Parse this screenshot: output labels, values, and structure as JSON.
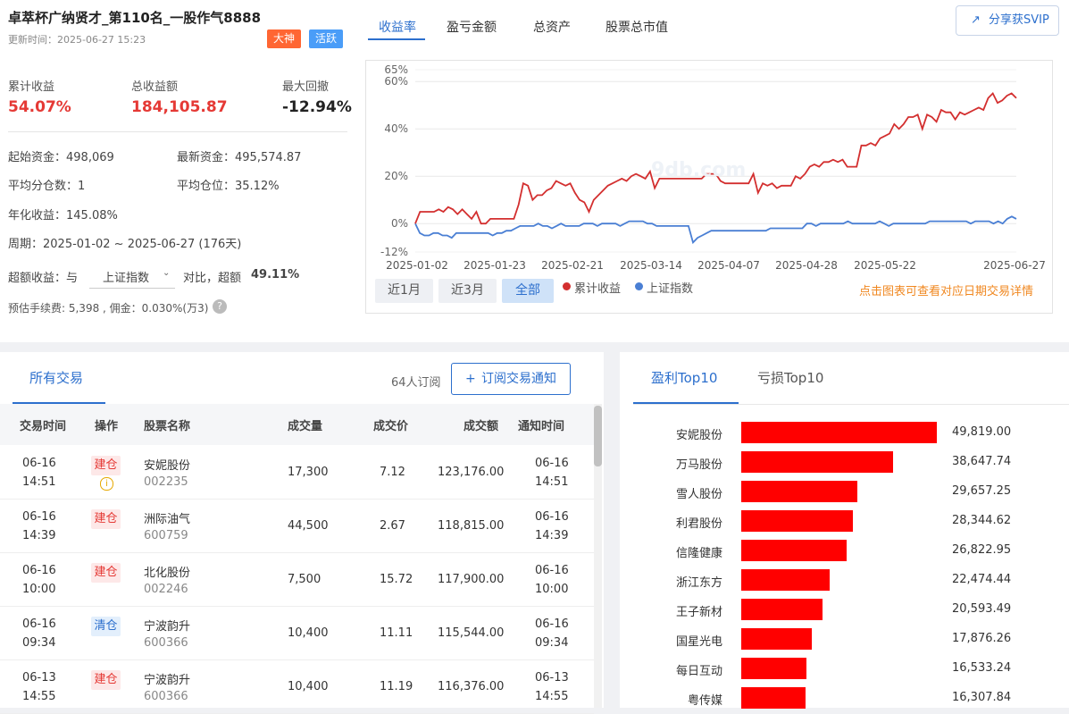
{
  "header": {
    "title": "卓萃杯广纳贤才_第110名_一股作气8888",
    "updated": "更新时间：2025-06-27 15:23",
    "badges": [
      {
        "label": "大神",
        "color": "#ff6633"
      },
      {
        "label": "活跃",
        "color": "#4a9df8"
      }
    ]
  },
  "stats": {
    "cumulative_label": "累计收益",
    "cumulative_value": "54.07%",
    "total_label": "总收益额",
    "total_value": "184,105.87",
    "drawdown_label": "最大回撤",
    "drawdown_value": "-12.94%"
  },
  "details": {
    "start_capital": "起始资金：498,069",
    "latest_capital": "最新资金：495,574.87",
    "avg_holdings": "平均分仓数：1",
    "avg_position": "平均仓位：35.12%",
    "annual": "年化收益：145.08%",
    "period": "周期：2025-01-02 ~ 2025-06-27 (176天)",
    "excess_prefix": "超额收益：与",
    "benchmark": "上证指数",
    "excess_mid": "对比，超额",
    "excess_value": "49.11%",
    "fees": "预估手续费: 5,398 , 佣金：0.030%(万3)"
  },
  "chart_tabs": [
    "收益率",
    "盈亏金额",
    "总资产",
    "股票总市值"
  ],
  "share_button": "分享获SVIP",
  "range_buttons": [
    "近1月",
    "近3月",
    "全部"
  ],
  "chart_hint": "点击图表可查看对应日期交易详情",
  "chart_data": {
    "type": "line",
    "y_ticks": [
      "65%",
      "60%",
      "40%",
      "20%",
      "0%",
      "-12%"
    ],
    "ylim": [
      -12,
      65
    ],
    "x_ticks": [
      "2025-01-02",
      "2025-01-23",
      "2025-02-21",
      "2025-03-14",
      "2025-04-07",
      "2025-04-28",
      "2025-05-22",
      "2025-06-27"
    ],
    "series": [
      {
        "name": "累计收益",
        "color": "#d32f2f",
        "values": [
          0,
          5,
          5,
          5,
          5,
          6,
          5,
          7,
          6,
          4,
          6,
          4,
          2,
          5,
          0,
          0,
          2,
          2,
          2,
          2,
          2,
          2,
          8,
          17,
          16,
          10,
          12,
          12,
          14,
          15,
          18,
          17,
          16,
          17,
          13,
          10,
          9,
          5,
          10,
          12,
          14,
          16,
          17,
          18,
          19,
          18,
          20,
          21,
          20,
          19,
          22,
          15,
          19,
          19,
          19,
          19,
          19,
          19,
          19,
          19,
          19,
          19,
          21,
          21,
          21,
          18,
          17,
          17,
          17,
          17,
          17,
          17,
          21,
          13,
          17,
          16,
          17,
          15,
          16,
          16,
          16,
          20,
          19,
          21,
          24,
          25,
          24,
          26,
          26,
          27,
          26,
          27,
          24,
          24,
          24,
          33,
          33,
          34,
          33,
          36,
          37,
          38,
          42,
          40,
          42,
          45,
          45,
          46,
          40,
          46,
          45,
          43,
          48,
          47,
          47,
          44,
          47,
          46,
          47,
          48,
          49,
          48,
          53,
          55,
          51,
          52,
          54,
          55,
          53
        ]
      },
      {
        "name": "上证指数",
        "color": "#4a7fd4",
        "values": [
          0,
          -4,
          -5,
          -5,
          -4,
          -4,
          -5,
          -5,
          -6,
          -4,
          -4,
          -4,
          -4,
          -4,
          -4,
          -4,
          -4,
          -5,
          -4,
          -4,
          -3,
          -3,
          -2,
          -1,
          -1,
          -1,
          -1,
          0,
          -1,
          -1,
          -2,
          -1,
          0,
          -1,
          -1,
          -1,
          -1,
          0,
          0,
          0,
          -1,
          0,
          0,
          0,
          0,
          -1,
          0,
          1,
          1,
          1,
          1,
          0,
          0,
          -1,
          -1,
          -1,
          -1,
          -1,
          -1,
          -1,
          -1,
          -8,
          -6,
          -5,
          -4,
          -3,
          -3,
          -3,
          -3,
          -3,
          -3,
          -3,
          -3,
          -3,
          -3,
          -3,
          -3,
          -3,
          -2,
          -2,
          -2,
          -2,
          -2,
          -2,
          -2,
          -2,
          0,
          0,
          -1,
          0,
          0,
          0,
          0,
          0,
          0,
          1,
          0,
          0,
          0,
          0,
          0,
          0,
          1,
          0,
          -1,
          0,
          0,
          0,
          0,
          0,
          0,
          0,
          0,
          1,
          1,
          1,
          1,
          1,
          1,
          1,
          1,
          1,
          0,
          1,
          1,
          1,
          1,
          0,
          1,
          0,
          2,
          3,
          2
        ]
      }
    ]
  },
  "trades": {
    "tab": "所有交易",
    "subscribers": "64人订阅",
    "subscribe_button": "订阅交易通知",
    "columns": [
      "交易时间",
      "操作",
      "股票名称",
      "成交量",
      "成交价",
      "成交额",
      "通知时间"
    ],
    "rows": [
      {
        "date": "06-16",
        "time": "14:51",
        "op": "建仓",
        "kind": "build",
        "name": "安妮股份",
        "code": "002235",
        "vol": "17,300",
        "price": "7.12",
        "amount": "123,176.00",
        "ndate": "06-16",
        "ntime": "14:51",
        "info": true
      },
      {
        "date": "06-16",
        "time": "14:39",
        "op": "建仓",
        "kind": "build",
        "name": "洲际油气",
        "code": "600759",
        "vol": "44,500",
        "price": "2.67",
        "amount": "118,815.00",
        "ndate": "06-16",
        "ntime": "14:39",
        "info": false
      },
      {
        "date": "06-16",
        "time": "10:00",
        "op": "建仓",
        "kind": "build",
        "name": "北化股份",
        "code": "002246",
        "vol": "7,500",
        "price": "15.72",
        "amount": "117,900.00",
        "ndate": "06-16",
        "ntime": "10:00",
        "info": false
      },
      {
        "date": "06-16",
        "time": "09:34",
        "op": "清仓",
        "kind": "clear",
        "name": "宁波韵升",
        "code": "600366",
        "vol": "10,400",
        "price": "11.11",
        "amount": "115,544.00",
        "ndate": "06-16",
        "ntime": "09:34",
        "info": false
      },
      {
        "date": "06-13",
        "time": "14:55",
        "op": "建仓",
        "kind": "build",
        "name": "宁波韵升",
        "code": "600366",
        "vol": "10,400",
        "price": "11.19",
        "amount": "116,376.00",
        "ndate": "06-13",
        "ntime": "14:55",
        "info": false
      }
    ]
  },
  "top": {
    "tabs": [
      "盈利Top10",
      "亏损Top10"
    ],
    "items": [
      {
        "name": "安妮股份",
        "value": 49819.0,
        "label": "49,819.00"
      },
      {
        "name": "万马股份",
        "value": 38647.74,
        "label": "38,647.74"
      },
      {
        "name": "雪人股份",
        "value": 29657.25,
        "label": "29,657.25"
      },
      {
        "name": "利君股份",
        "value": 28344.62,
        "label": "28,344.62"
      },
      {
        "name": "信隆健康",
        "value": 26822.95,
        "label": "26,822.95"
      },
      {
        "name": "浙江东方",
        "value": 22474.44,
        "label": "22,474.44"
      },
      {
        "name": "王子新材",
        "value": 20593.49,
        "label": "20,593.49"
      },
      {
        "name": "国星光电",
        "value": 17876.26,
        "label": "17,876.26"
      },
      {
        "name": "每日互动",
        "value": 16533.24,
        "label": "16,533.24"
      },
      {
        "name": "粤传媒",
        "value": 16307.84,
        "label": "16,307.84"
      }
    ]
  }
}
